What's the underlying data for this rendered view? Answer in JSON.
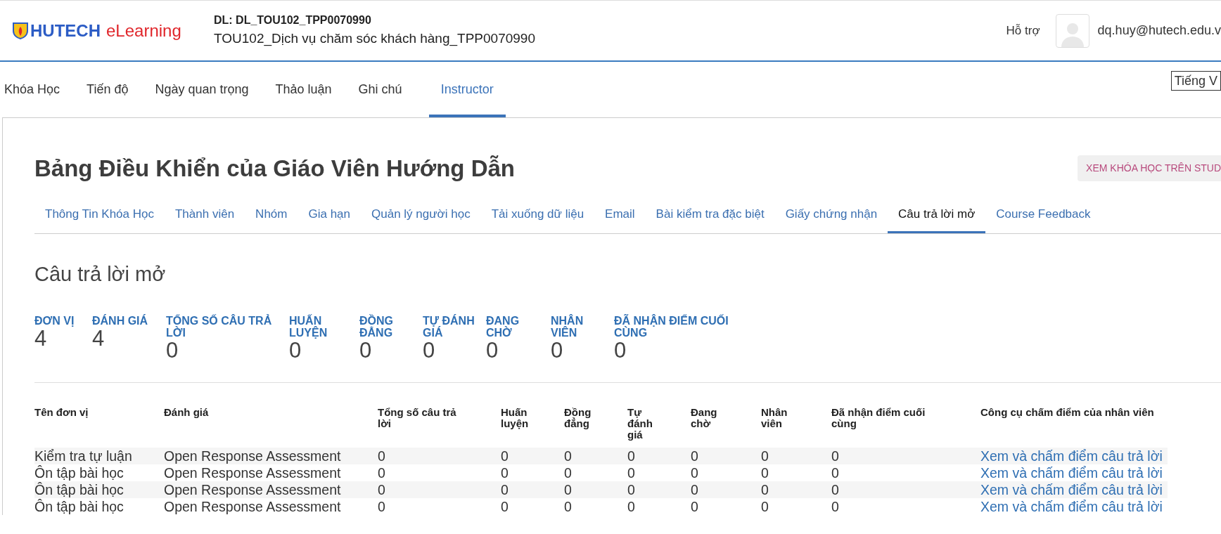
{
  "header": {
    "logo": {
      "brand": "HUTECH",
      "suffix": "eLearning"
    },
    "course": {
      "code": "DL: DL_TOU102_TPP0070990",
      "title": "TOU102_Dịch vụ chăm sóc khách hàng_TPP0070990"
    },
    "help": "Hỗ trợ",
    "user_email": "dq.huy@hutech.edu.v"
  },
  "course_tabs": [
    {
      "label": "Khóa Học",
      "selected": false
    },
    {
      "label": "Tiến độ",
      "selected": false
    },
    {
      "label": "Ngày quan trọng",
      "selected": false
    },
    {
      "label": "Thảo luận",
      "selected": false
    },
    {
      "label": "Ghi chú",
      "selected": false
    },
    {
      "label": "Instructor",
      "selected": true
    }
  ],
  "language_select": {
    "value": "Tiếng V"
  },
  "dashboard": {
    "title": "Bảng Điều Khiển của Giáo Viên Hướng Dẫn",
    "view_button": "XEM KHÓA HỌC TRÊN STUD",
    "tabs": [
      {
        "label": "Thông Tin Khóa Học",
        "selected": false
      },
      {
        "label": "Thành viên",
        "selected": false
      },
      {
        "label": "Nhóm",
        "selected": false
      },
      {
        "label": "Gia hạn",
        "selected": false
      },
      {
        "label": "Quản lý người học",
        "selected": false
      },
      {
        "label": "Tải xuống dữ liệu",
        "selected": false
      },
      {
        "label": "Email",
        "selected": false
      },
      {
        "label": "Bài kiểm tra đặc biệt",
        "selected": false
      },
      {
        "label": "Giấy chứng nhận",
        "selected": false
      },
      {
        "label": "Câu trả lời mở",
        "selected": true
      },
      {
        "label": "Course Feedback",
        "selected": false
      }
    ],
    "section_title": "Câu trả lời mở",
    "stats": [
      {
        "label": "ĐƠN VỊ",
        "value": "4"
      },
      {
        "label": "ĐÁNH GIÁ",
        "value": "4"
      },
      {
        "label": "TỔNG SỐ CÂU TRẢ LỜI",
        "value": "0"
      },
      {
        "label": "HUẤN LUYỆN",
        "value": "0"
      },
      {
        "label": "ĐỒNG ĐẲNG",
        "value": "0"
      },
      {
        "label": "TỰ ĐÁNH GIÁ",
        "value": "0"
      },
      {
        "label": "ĐANG CHỜ",
        "value": "0"
      },
      {
        "label": "NHÂN VIÊN",
        "value": "0"
      },
      {
        "label": "ĐÃ NHẬN ĐIỂM CUỐI CÙNG",
        "value": "0"
      }
    ],
    "table": {
      "columns": [
        "Tên đơn vị",
        "Đánh giá",
        "Tổng số câu trả lời",
        "Huấn luyện",
        "Đồng đẳng",
        "Tự đánh giá",
        "Đang chờ",
        "Nhân viên",
        "Đã nhận điểm cuối cùng",
        "Công cụ chấm điểm của nhân viên"
      ],
      "rows": [
        {
          "unit": "Kiểm tra tự luận",
          "assessment": "Open Response Assessment",
          "counts": [
            "0",
            "0",
            "0",
            "0",
            "0",
            "0",
            "0"
          ],
          "action": "Xem và chấm điểm câu trả lời"
        },
        {
          "unit": "Ôn tập bài học",
          "assessment": "Open Response Assessment",
          "counts": [
            "0",
            "0",
            "0",
            "0",
            "0",
            "0",
            "0"
          ],
          "action": "Xem và chấm điểm câu trả lời"
        },
        {
          "unit": "Ôn tập bài học",
          "assessment": "Open Response Assessment",
          "counts": [
            "0",
            "0",
            "0",
            "0",
            "0",
            "0",
            "0"
          ],
          "action": "Xem và chấm điểm câu trả lời"
        },
        {
          "unit": "Ôn tập bài học",
          "assessment": "Open Response Assessment",
          "counts": [
            "0",
            "0",
            "0",
            "0",
            "0",
            "0",
            "0"
          ],
          "action": "Xem và chấm điểm câu trả lời"
        }
      ]
    }
  }
}
